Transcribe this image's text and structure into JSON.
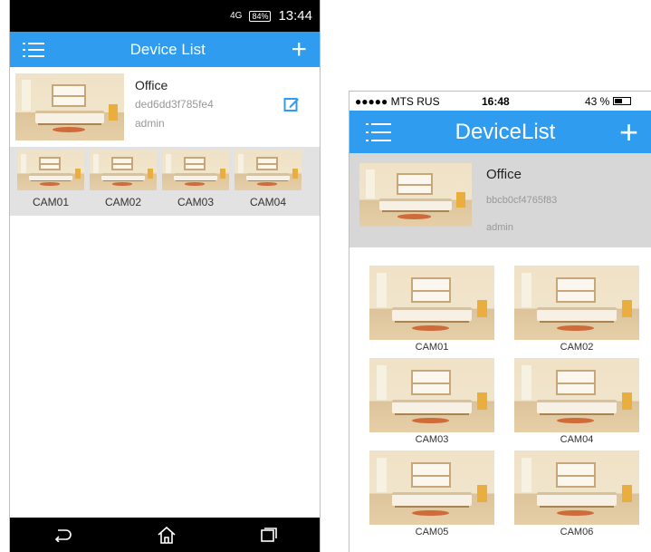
{
  "android": {
    "status": {
      "signal": "4G",
      "battery": "84%",
      "time": "13:44"
    },
    "header": {
      "title": "Device List"
    },
    "device": {
      "name": "Office",
      "serial": "ded6dd3f785fe4",
      "user": "admin"
    },
    "cameras": [
      "CAM01",
      "CAM02",
      "CAM03",
      "CAM04"
    ]
  },
  "ios": {
    "status": {
      "carrier": "●●●●● MTS RUS",
      "time": "16:48",
      "battery": "43 %"
    },
    "header": {
      "title": "DeviceList"
    },
    "device": {
      "name": "Office",
      "serial": "bbcb0cf4765f83",
      "user": "admin"
    },
    "cameras": [
      "CAM01",
      "CAM02",
      "CAM03",
      "CAM04",
      "CAM05",
      "CAM06"
    ]
  },
  "icons": {
    "menu": "menu-list-icon",
    "add": "plus-icon",
    "edit": "edit-icon",
    "back": "back-icon",
    "home": "home-icon",
    "recents": "recents-icon"
  },
  "colors": {
    "accent": "#2f9cf0"
  }
}
